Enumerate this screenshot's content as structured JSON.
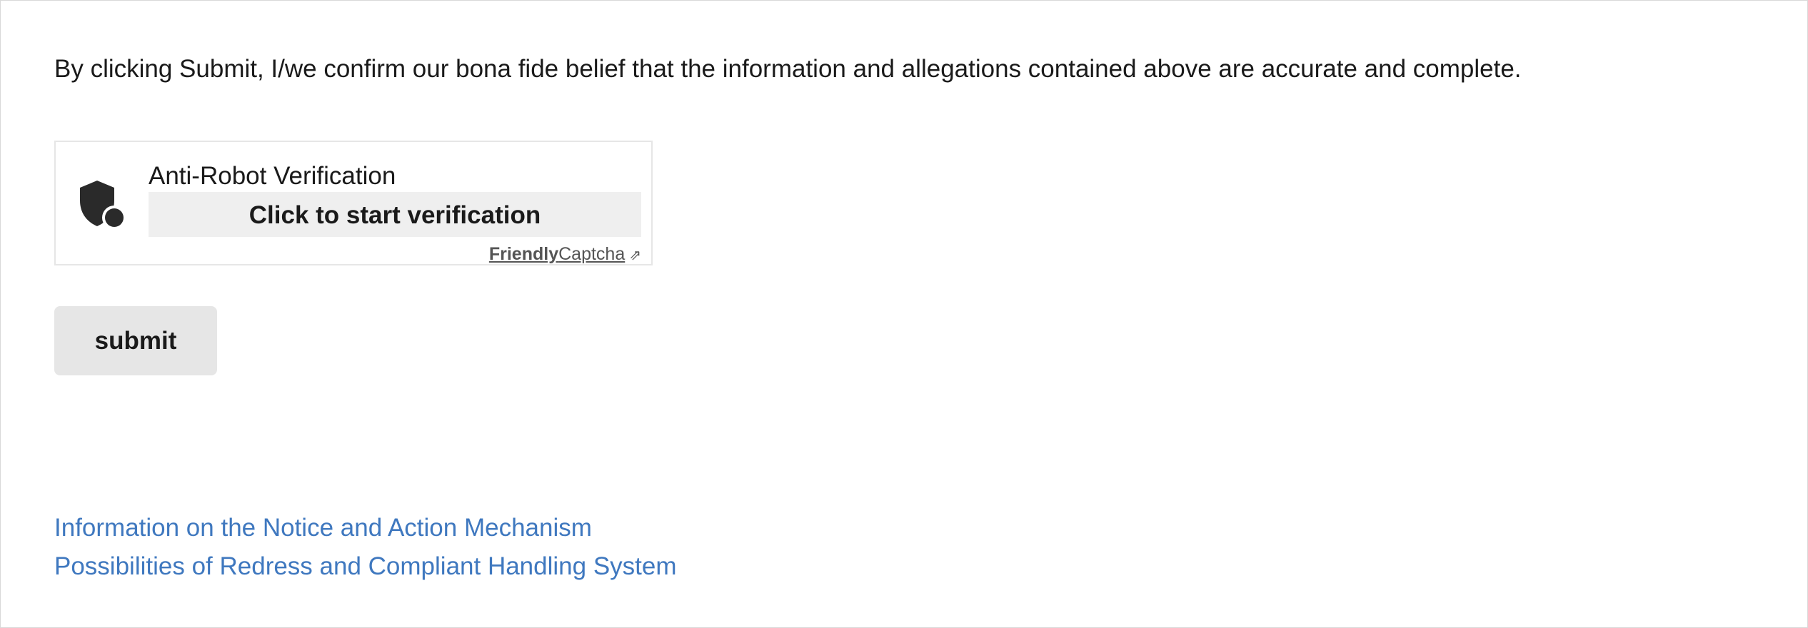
{
  "form": {
    "confirmation_text": "By clicking Submit, I/we confirm our bona fide belief that the information and allegations contained above are accurate and complete.",
    "submit_label": "submit"
  },
  "captcha": {
    "title": "Anti-Robot Verification",
    "button_label": "Click to start verification",
    "brand_strong": "Friendly",
    "brand_rest": "Captcha",
    "icon": "shield-icon",
    "external_icon": "external-link-icon"
  },
  "footer_links": [
    {
      "label": "Information on the Notice and Action Mechanism"
    },
    {
      "label": "Possibilities of Redress and Compliant Handling System"
    }
  ],
  "colors": {
    "link": "#3f78bf",
    "button_bg": "#e6e6e6",
    "captcha_button_bg": "#efefef",
    "text": "#1a1a1a"
  }
}
